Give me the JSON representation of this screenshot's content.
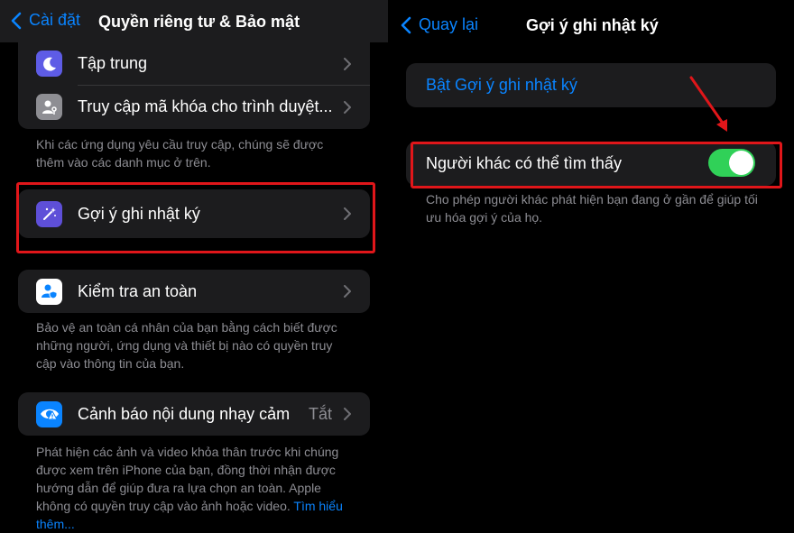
{
  "left": {
    "nav": {
      "back_label": "Cài đặt",
      "title": "Quyền riêng tư & Bảo mật"
    },
    "rows": {
      "focus": {
        "label": "Tập trung"
      },
      "passkey": {
        "label": "Truy cập mã khóa cho trình duyệt..."
      },
      "journal": {
        "label": "Gợi ý ghi nhật ký"
      },
      "safety": {
        "label": "Kiểm tra an toàn"
      },
      "sensitive": {
        "label": "Cảnh báo nội dung nhạy cảm",
        "value": "Tắt"
      }
    },
    "footers": {
      "apps": "Khi các ứng dụng yêu cầu truy cập, chúng sẽ được thêm vào các danh mục ở trên.",
      "safety": "Bảo vệ an toàn cá nhân của bạn bằng cách biết được những người, ứng dụng và thiết bị nào có quyền truy cập vào thông tin của bạn.",
      "sensitive": "Phát hiện các ảnh và video khỏa thân trước khi chúng được xem trên iPhone của bạn, đồng thời nhận được hướng dẫn để giúp đưa ra lựa chọn an toàn. Apple không có quyền truy cập vào ảnh hoặc video.",
      "sensitive_link": "Tìm hiểu thêm..."
    }
  },
  "right": {
    "nav": {
      "back_label": "Quay lại",
      "title": "Gợi ý ghi nhật ký"
    },
    "enable_button": "Bật Gợi ý ghi nhật ký",
    "discoverable": {
      "label": "Người khác có thể tìm thấy",
      "enabled": true
    },
    "footer": "Cho phép người khác phát hiện bạn đang ở gần để giúp tối ưu hóa gợi ý của họ."
  },
  "colors": {
    "accent": "#0a84ff",
    "toggle_on": "#30d158",
    "highlight": "#e0161a",
    "focus_icon_bg": "#5e5ce6",
    "journal_icon_bg": "#5e4fd8",
    "safety_icon_bg": "#ffffff",
    "sensitive_icon_bg": "#0a84ff"
  }
}
